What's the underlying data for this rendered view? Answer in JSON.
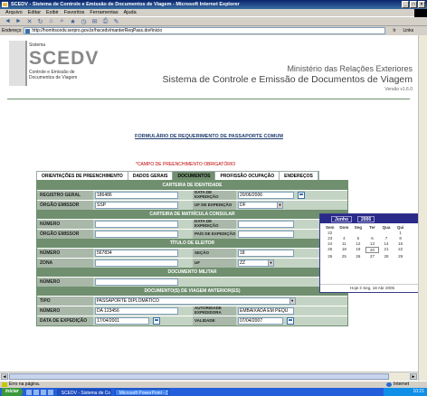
{
  "window": {
    "title": "SCEDV - Sistema de Controle e Emissão de Documentos de Viagem - Microsoft Internet Explorer"
  },
  "menu": [
    "Arquivo",
    "Editar",
    "Exibir",
    "Favoritos",
    "Ferramentas",
    "Ajuda"
  ],
  "address": {
    "label": "Endereço",
    "url": "http://homhscedv.serpro.gov.br/hscedv/manterReqPass.do#inicio",
    "go": "Ir",
    "links": "Links"
  },
  "header": {
    "sistema": "Sistema",
    "logo": "SCEDV",
    "logo_sub": "Controle e Emissão de Documentos de Viagem",
    "ministry": "Ministério das Relações Exteriores",
    "system_name": "Sistema de Controle e Emissão de Documentos de Viagem",
    "version": "Versão v1.6.0"
  },
  "form_title": "FORMULÁRIO DE REQUERIMENTO DE PASSAPORTE COMUM",
  "required_note": "*CAMPO DE PREENCHIMENTO OBRIGATÓRIO",
  "tabs": [
    "ORIENTAÇÕES DE PREENCHIMENTO",
    "DADOS GERAIS",
    "DOCUMENTOS",
    "PROFISSÃO OCUPAÇÃO",
    "ENDEREÇOS"
  ],
  "sections": {
    "identidade": "CARTEIRA DE IDENTIDADE",
    "matricula": "CARTEIRA DE MATRÍCULA CONSULAR",
    "titulo": "TÍTULO DE ELEITOR",
    "militar": "DOCUMENTO MILITAR",
    "anteriores": "DOCUMENTO(S) DE VIAGEM ANTERIOR(ES)"
  },
  "fields": {
    "registro_geral": {
      "label": "REGISTRO GERAL",
      "value": "186486"
    },
    "data_expedicao_id": {
      "label": "DATA DE EXPEDIÇÃO",
      "value": "20/06/2006"
    },
    "orgao_emissor_id": {
      "label": "ÓRGÃO EMISSOR",
      "value": "SSP"
    },
    "uf_expedicao": {
      "label": "UF DE EXPEDIÇÃO",
      "value": "DF"
    },
    "numero_mat": {
      "label": "NÚMERO",
      "value": ""
    },
    "data_expedicao_mat": {
      "label": "DATA DE EXPEDIÇÃO",
      "value": ""
    },
    "orgao_emissor_mat": {
      "label": "ÓRGÃO EMISSOR",
      "value": ""
    },
    "pais_expedicao": {
      "label": "PAÍS DE EXPEDIÇÃO",
      "value": ""
    },
    "numero_titulo": {
      "label": "NÚMERO",
      "value": "567834"
    },
    "secao": {
      "label": "SEÇÃO",
      "value": "18"
    },
    "zona": {
      "label": "ZONA",
      "value": ""
    },
    "uf_titulo": {
      "label": "UF",
      "value": "ZZ"
    },
    "numero_militar": {
      "label": "NÚMERO",
      "value": ""
    },
    "tipo": {
      "label": "TIPO",
      "value": "PASSAPORTE DIPLOMÁTICO"
    },
    "numero_viagem": {
      "label": "NÚMERO",
      "value": "DA 123456"
    },
    "autoridade": {
      "label": "AUTORIDADE EXPEDIDORA",
      "value": "EMBAIXADA EM PEQU"
    },
    "data_expedicao_viagem": {
      "label": "DATA DE EXPEDIÇÃO",
      "value": "17/04/2001"
    },
    "validade": {
      "label": "VALIDADE",
      "value": "07/04/2007"
    }
  },
  "calendar": {
    "month": "Junho",
    "year": "2006",
    "weekdays": [
      "Sem",
      "Dom",
      "Seg",
      "Ter",
      "Qua",
      "Qui"
    ],
    "rows": [
      [
        "22",
        "",
        "",
        "",
        "",
        "1"
      ],
      [
        "23",
        "4",
        "5",
        "6",
        "7",
        "8"
      ],
      [
        "24",
        "11",
        "12",
        "13",
        "14",
        "15"
      ],
      [
        "25",
        "18",
        "19",
        "20",
        "21",
        "22"
      ],
      [
        "26",
        "25",
        "26",
        "27",
        "28",
        "29"
      ]
    ],
    "today": "Hoje é Seg, 18 Abr 2006"
  },
  "status": {
    "left": "Erro na página.",
    "zone": "Internet"
  },
  "taskbar": {
    "start": "Iniciar",
    "tasks": [
      "SCEDV - Sistema de Co...",
      "Microsoft PowerPoint - [1..."
    ],
    "clock": "10:21"
  }
}
